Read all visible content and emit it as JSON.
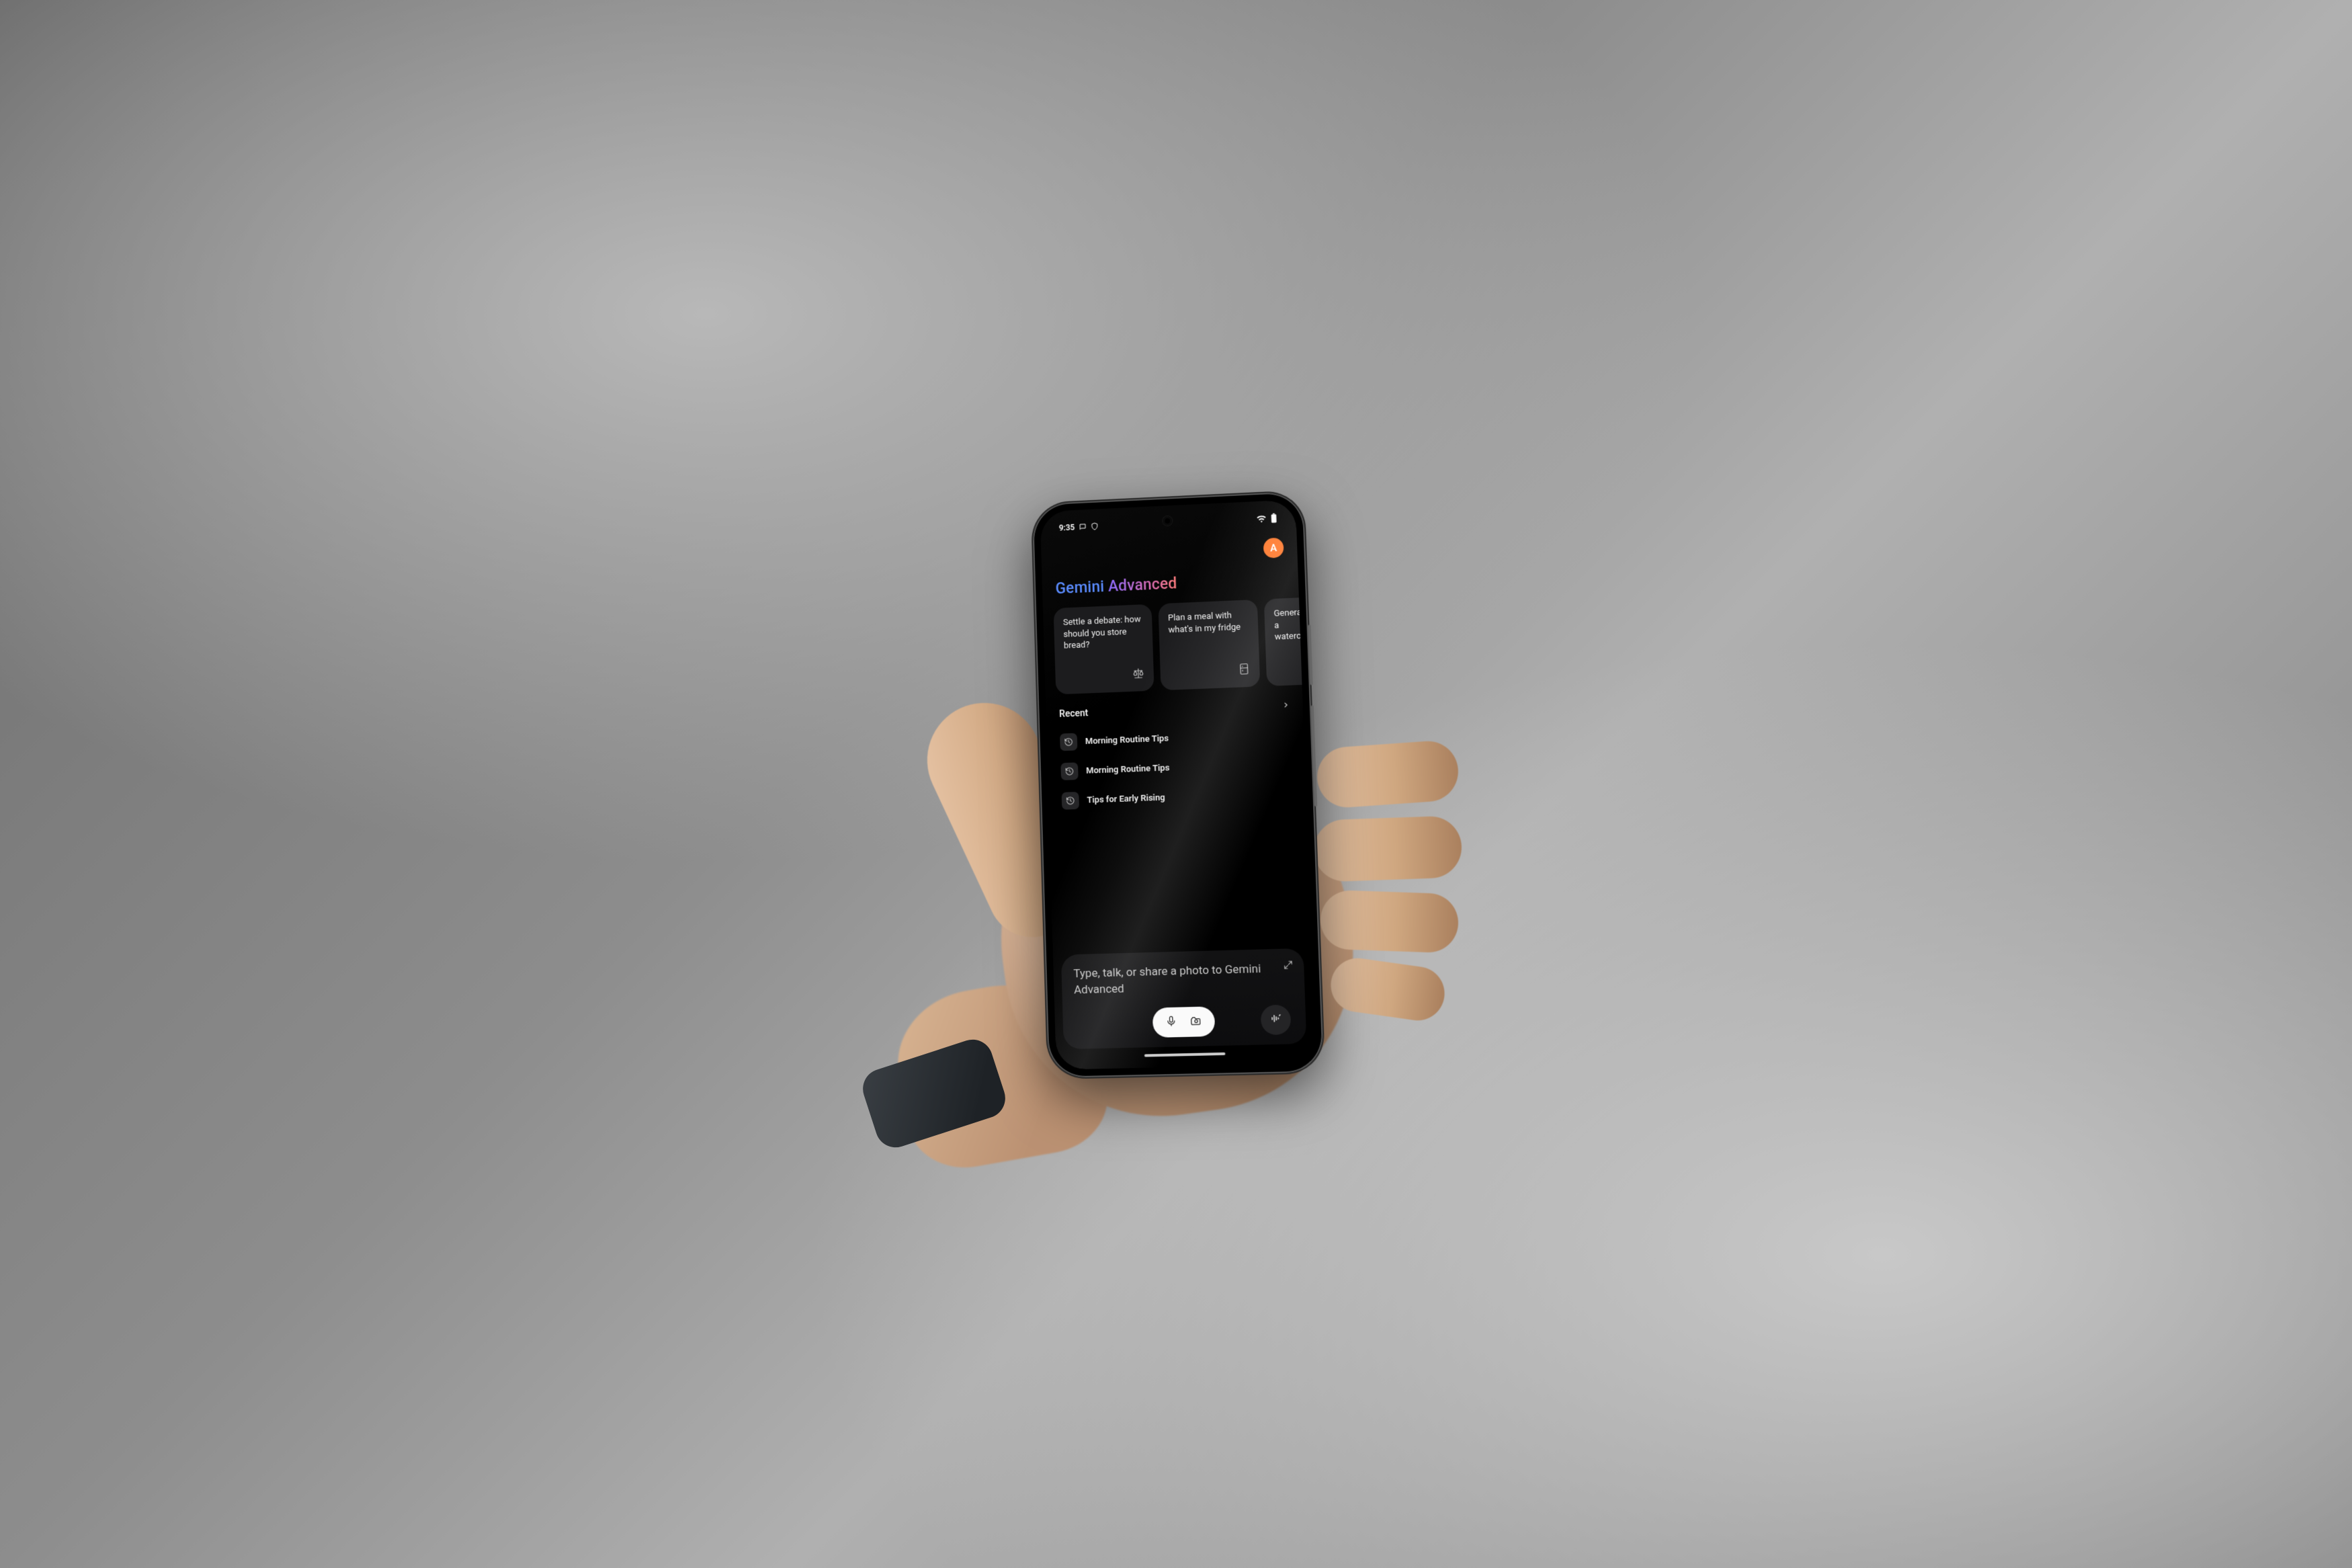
{
  "status": {
    "time": "9:35",
    "notification_icons": [
      "chat-icon",
      "shield-icon"
    ]
  },
  "profile": {
    "initial": "A",
    "avatar_color": "#ff7a2e"
  },
  "app_title": {
    "word1": "Gemini",
    "word2": "Advanced"
  },
  "suggestions": [
    {
      "text": "Settle a debate: how should you store bread?",
      "icon": "balance-icon"
    },
    {
      "text": "Plan a meal with what's in my fridge",
      "icon": "fridge-icon"
    },
    {
      "text": "Generate a watercolor",
      "icon": "image-icon"
    }
  ],
  "recent": {
    "heading": "Recent",
    "items": [
      {
        "title": "Morning Routine Tips"
      },
      {
        "title": "Morning Routine Tips"
      },
      {
        "title": "Tips for Early Rising"
      }
    ]
  },
  "composer": {
    "placeholder": "Type, talk, or share a photo to Gemini Advanced"
  }
}
